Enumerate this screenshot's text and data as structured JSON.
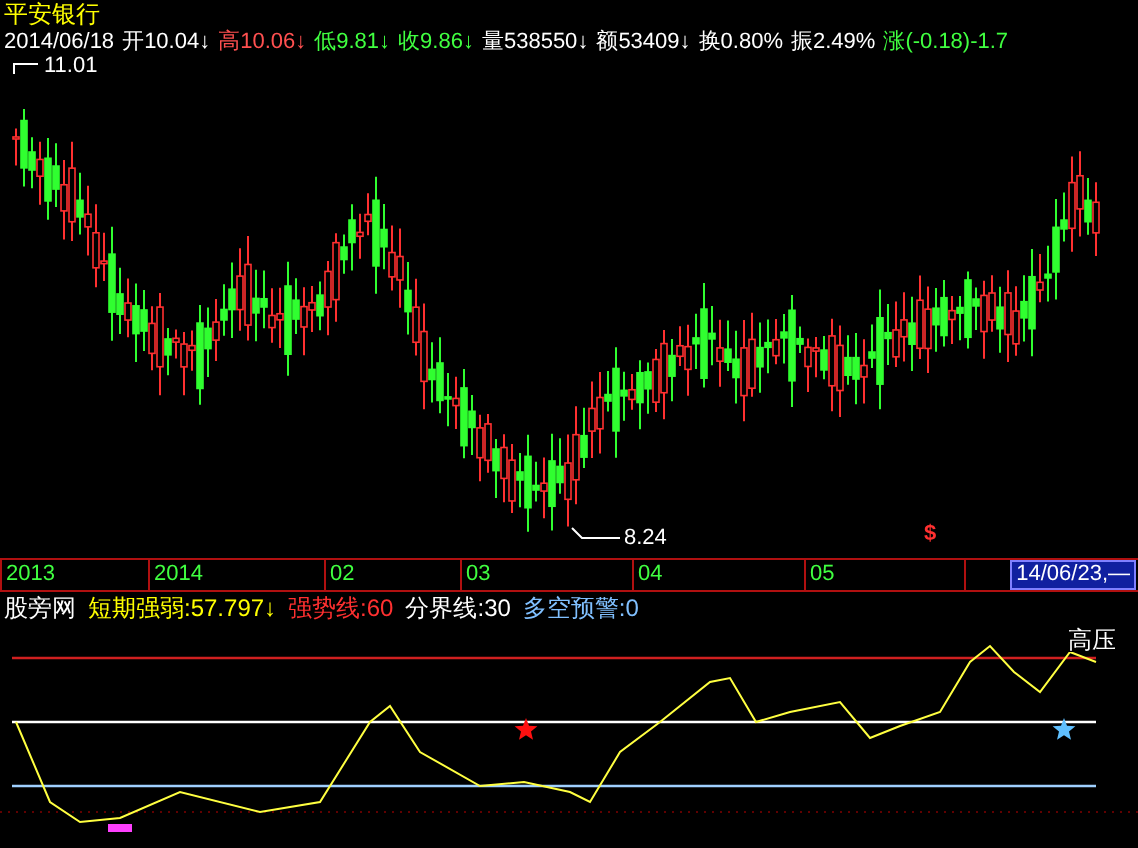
{
  "title": "平安银行",
  "date": "2014/06/18",
  "quote": [
    {
      "label": "开",
      "value": "10.04",
      "arrow": "↓",
      "color": "#ffffff"
    },
    {
      "label": "高",
      "value": "10.06",
      "arrow": "↓",
      "color": "#ff5050"
    },
    {
      "label": "低",
      "value": "9.81",
      "arrow": "↓",
      "color": "#40ff40"
    },
    {
      "label": "收",
      "value": "9.86",
      "arrow": "↓",
      "color": "#40ff40"
    },
    {
      "label": "量",
      "value": "538550",
      "arrow": "↓",
      "color": "#ffffff"
    },
    {
      "label": "额",
      "value": "53409",
      "arrow": "↓",
      "color": "#ffffff"
    },
    {
      "label": "换",
      "value": "0.80%",
      "color": "#ffffff"
    },
    {
      "label": "振",
      "value": "2.49%",
      "color": "#ffffff"
    },
    {
      "label": "涨",
      "value": "(-0.18)-1.7",
      "color": "#40ff40"
    }
  ],
  "price_chart": {
    "high_label": "11.01",
    "low_label": "8.24",
    "marker": "$"
  },
  "time_axis": {
    "labels": [
      "2013",
      "2014",
      "02",
      "03",
      "04",
      "05"
    ],
    "cursor_date": "14/06/23,—"
  },
  "indicator": {
    "legend": [
      {
        "text": "股旁网",
        "color": "#ffffff"
      },
      {
        "text": "短期强弱:57.797↓",
        "color": "#ffff00"
      },
      {
        "text": "强势线:60",
        "color": "#ff3030"
      },
      {
        "text": "分界线:30",
        "color": "#ffffff"
      },
      {
        "text": "多空预警:0",
        "color": "#80c0ff"
      }
    ],
    "signal_label": "高压"
  }
}
